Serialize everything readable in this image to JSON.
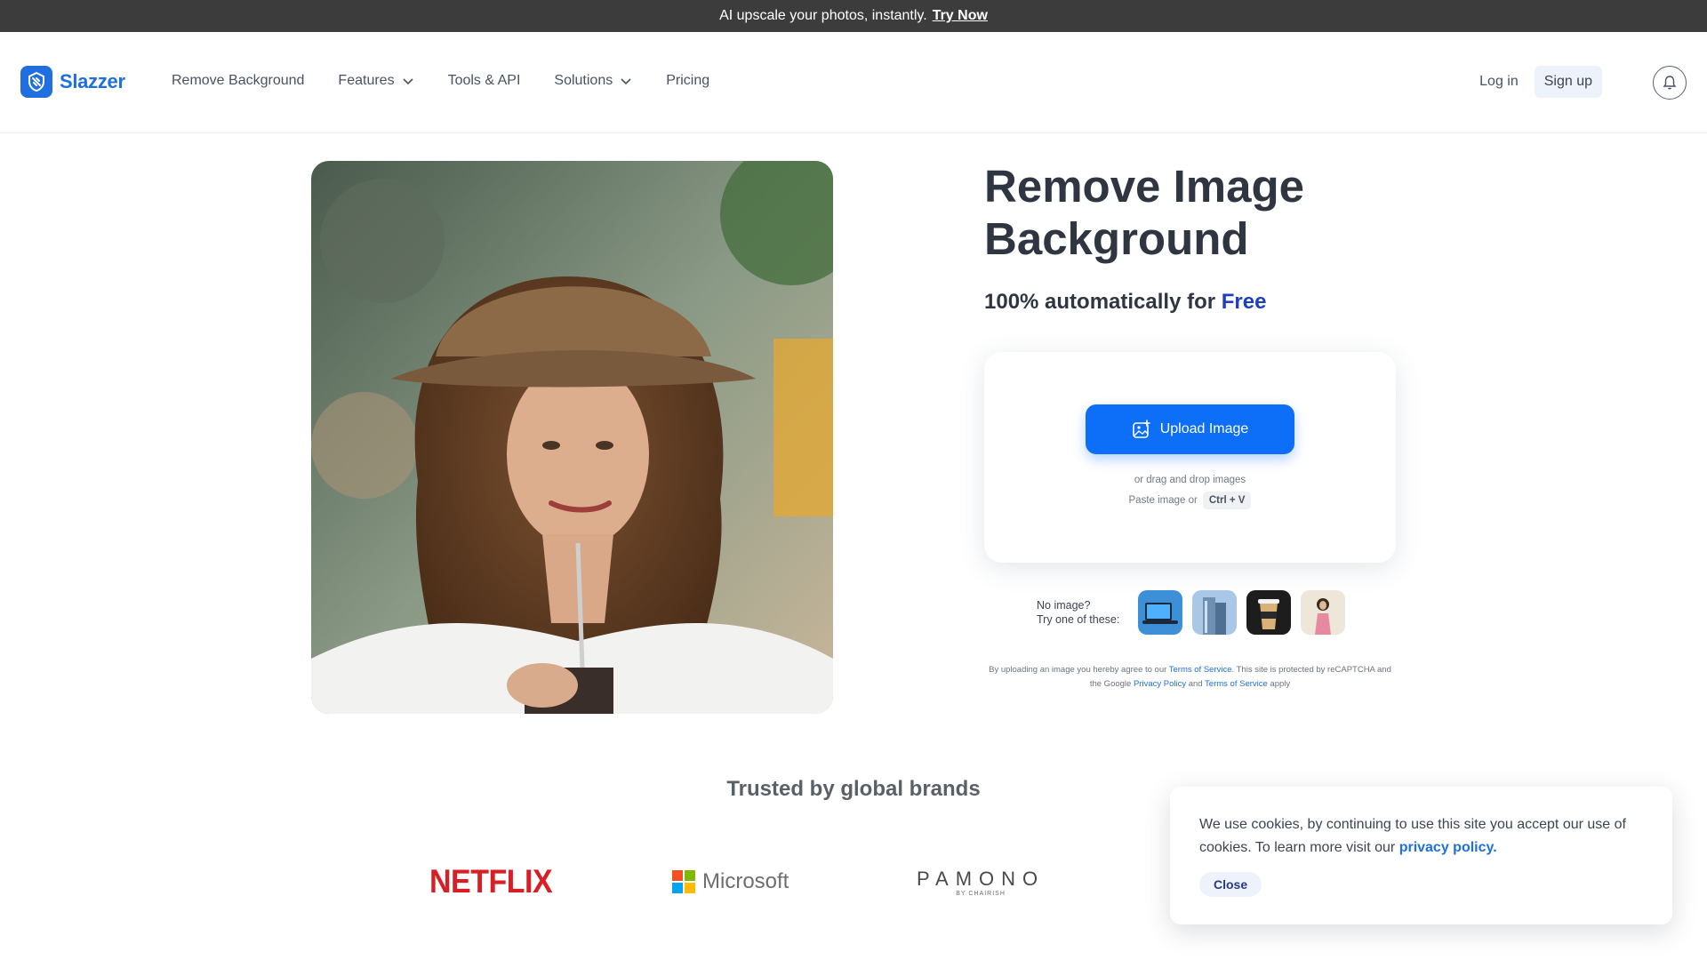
{
  "announcement": {
    "text": "AI upscale your photos, instantly.",
    "link": "Try Now"
  },
  "brand": {
    "name": "Slazzer",
    "color": "#1f6fe0",
    "logo_icon": "slazzer-logo-icon"
  },
  "nav": {
    "items": [
      {
        "label": "Remove Background",
        "dropdown": false
      },
      {
        "label": "Features",
        "dropdown": true
      },
      {
        "label": "Tools & API",
        "dropdown": false
      },
      {
        "label": "Solutions",
        "dropdown": true
      },
      {
        "label": "Pricing",
        "dropdown": false
      }
    ],
    "login": "Log in",
    "signup": "Sign up",
    "notification_icon": "bell-icon"
  },
  "hero": {
    "title": "Remove Image Background",
    "subtitle_prefix": "100% automatically for ",
    "subtitle_highlight": "Free",
    "highlight_color": "#1d3fbf"
  },
  "upload": {
    "button": "Upload Image",
    "button_color": "#0d6ef7",
    "drag_text": "or drag and drop images",
    "paste_text": "Paste image or",
    "shortcut": "Ctrl + V"
  },
  "samples": {
    "label_line1": "No image?",
    "label_line2": "Try one of these:",
    "items": [
      "laptop",
      "building",
      "coffee-cup",
      "woman"
    ]
  },
  "legal": {
    "part1": "By uploading an image you hereby agree to our ",
    "tos": "Terms of Service",
    "part2": ". This site is protected by reCAPTCHA and the Google ",
    "privacy": "Privacy Policy",
    "part3": " and ",
    "tos2": "Terms of Service",
    "part4": " apply"
  },
  "brands": {
    "title": "Trusted by global brands",
    "logos": [
      "NETFLIX",
      "Microsoft",
      "PAMONO"
    ],
    "pamono_sub": "BY CHAIRISH"
  },
  "cookie": {
    "text": "We use cookies, by continuing to use this site you accept our use of cookies.  To learn more visit our ",
    "link": "privacy policy.",
    "close": "Close"
  }
}
